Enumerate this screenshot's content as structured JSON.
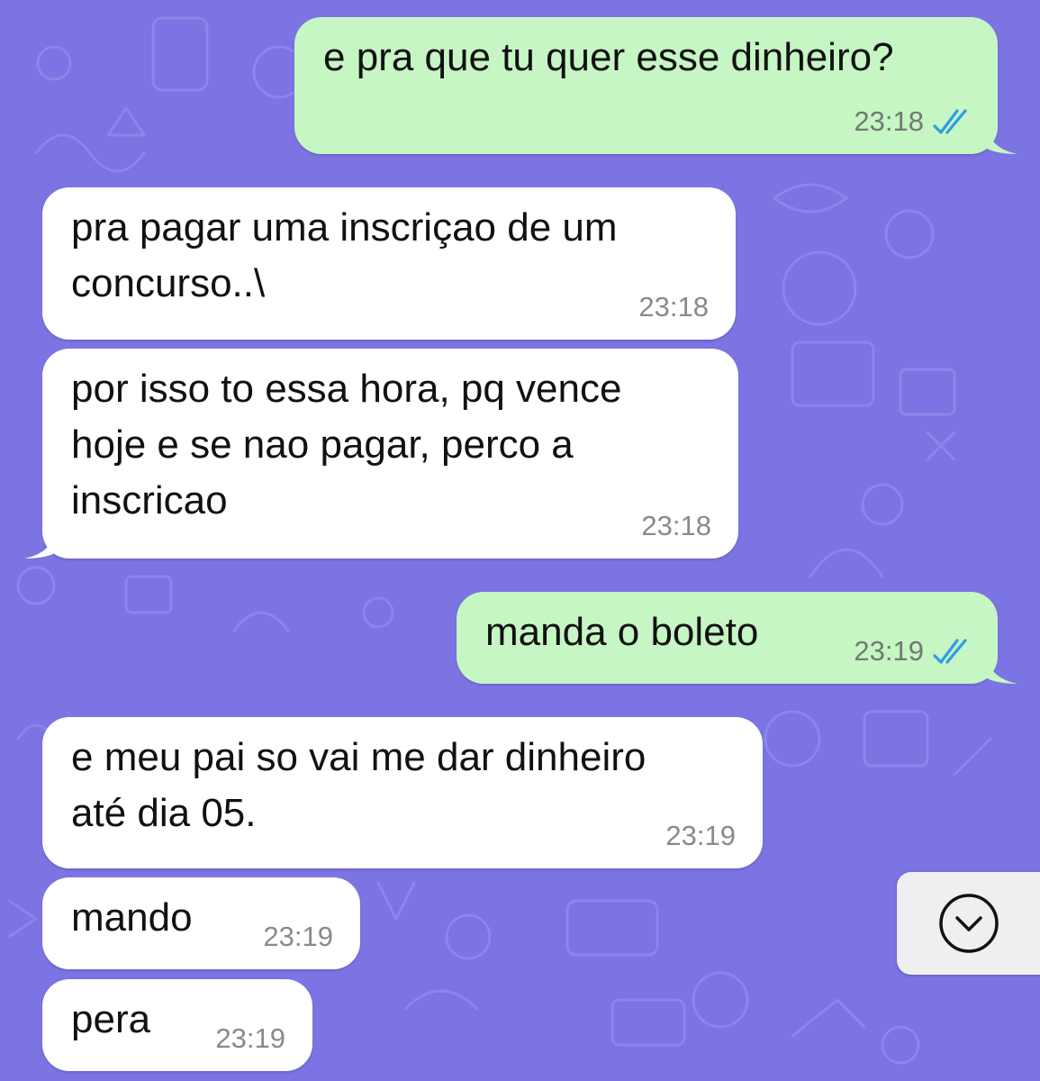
{
  "messages": [
    {
      "direction": "out",
      "text": "e pra que tu quer esse dinheiro?",
      "time": "23:18",
      "status": "read"
    },
    {
      "direction": "in",
      "text": "pra pagar uma inscriçao de um\nconcurso..\\",
      "time": "23:18"
    },
    {
      "direction": "in",
      "text": "por isso to essa hora, pq vence\nhoje e se nao pagar, perco a\ninscricao",
      "time": "23:18"
    },
    {
      "direction": "out",
      "text": "manda o boleto",
      "time": "23:19",
      "status": "read"
    },
    {
      "direction": "in",
      "text": "e meu pai so vai me dar dinheiro\naté dia 05.",
      "time": "23:19"
    },
    {
      "direction": "in",
      "text": "mando",
      "time": "23:19"
    },
    {
      "direction": "in",
      "text": "pera",
      "time": "23:19"
    }
  ],
  "icons": {
    "read_receipt": "double-check-icon",
    "scroll_down": "chevron-down-circle-icon"
  },
  "colors": {
    "background": "#7b74e2",
    "outgoing_bubble": "#c6f6c4",
    "incoming_bubble": "#ffffff",
    "read_check": "#2f9be8",
    "timestamp": "#6f7a72"
  }
}
